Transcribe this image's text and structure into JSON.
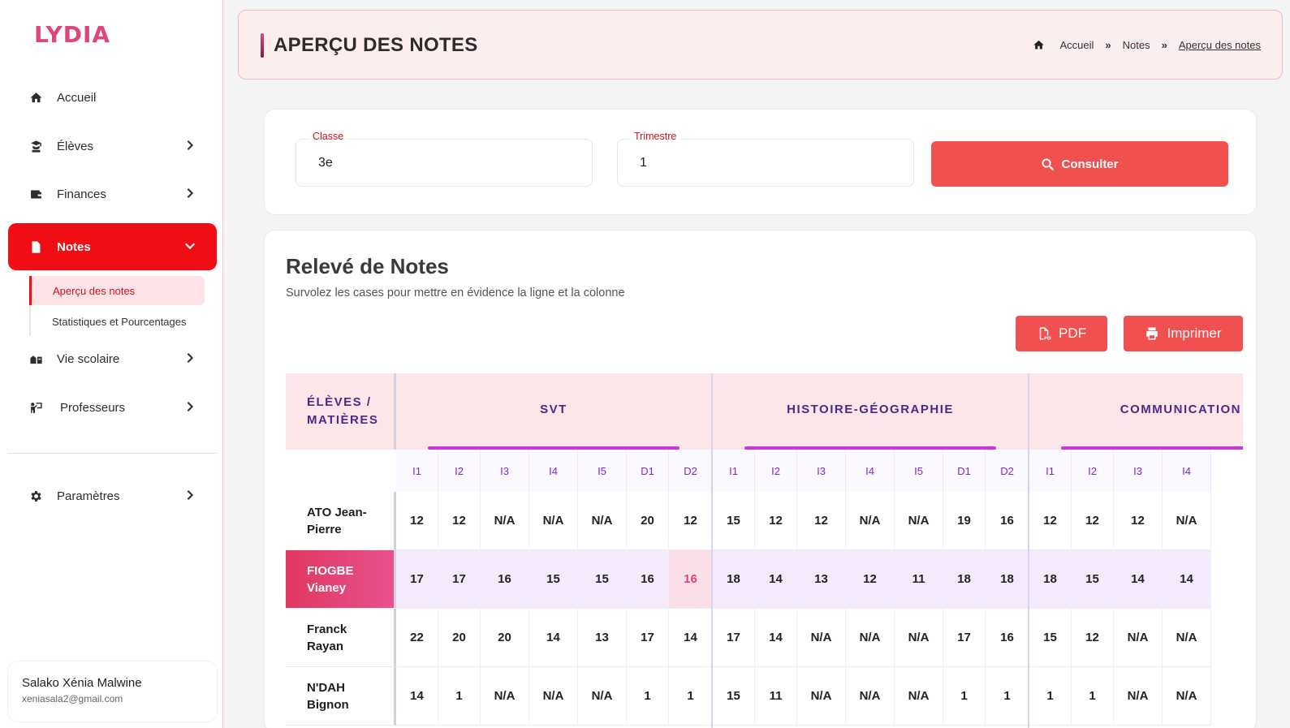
{
  "brand": "LYDIA",
  "sidebar": {
    "items": [
      {
        "label": "Accueil",
        "icon": "home-icon"
      },
      {
        "label": "Élèves",
        "icon": "student-icon"
      },
      {
        "label": "Finances",
        "icon": "wallet-icon"
      },
      {
        "label": "Notes",
        "icon": "document-icon"
      },
      {
        "label": "Vie scolaire",
        "icon": "school-life-icon"
      },
      {
        "label": "Professeurs",
        "icon": "teacher-icon"
      },
      {
        "label": "Paramètres",
        "icon": "gear-icon"
      }
    ],
    "sub_items": [
      "Aperçu des notes",
      "Statistiques et Pourcentages"
    ]
  },
  "user": {
    "name": "Salako Xénia Malwine",
    "email": "xeniasala2@gmail.com"
  },
  "header": {
    "title": "APERÇU DES NOTES",
    "breadcrumb": [
      "Accueil",
      "Notes",
      "Aperçu des notes"
    ]
  },
  "filters": {
    "classe_label": "Classe",
    "classe_value": "3e",
    "trimestre_label": "Trimestre",
    "trimestre_value": "1",
    "consult_label": "Consulter"
  },
  "grades": {
    "title": "Relevé de Notes",
    "hint": "Survolez les cases pour mettre en évidence la ligne et la colonne",
    "pdf_label": "PDF",
    "print_label": "Imprimer",
    "corner_label_1": "ÉLÈVES /",
    "corner_label_2": "MATIÈRES",
    "subjects": [
      "SVT",
      "HISTOIRE-GÉOGRAPHIE",
      "COMMUNICATION E"
    ],
    "evals": [
      "I1",
      "I2",
      "I3",
      "I4",
      "I5",
      "D1",
      "D2",
      "I1",
      "I2",
      "I3",
      "I4",
      "I5",
      "D1",
      "D2",
      "I1",
      "I2",
      "I3",
      "I4"
    ],
    "students": [
      {
        "line1": "ATO Jean-",
        "line2": "Pierre",
        "notes": [
          "12",
          "12",
          "N/A",
          "N/A",
          "N/A",
          "20",
          "12",
          "15",
          "12",
          "12",
          "N/A",
          "N/A",
          "19",
          "16",
          "12",
          "12",
          "12",
          "N/A"
        ]
      },
      {
        "line1": "FIOGBE",
        "line2": "Vianey",
        "notes": [
          "17",
          "17",
          "16",
          "15",
          "15",
          "16",
          "16",
          "18",
          "14",
          "13",
          "12",
          "11",
          "18",
          "18",
          "18",
          "15",
          "14",
          "14"
        ]
      },
      {
        "line1": "Franck",
        "line2": "Rayan",
        "notes": [
          "22",
          "20",
          "20",
          "14",
          "13",
          "17",
          "14",
          "17",
          "14",
          "N/A",
          "N/A",
          "N/A",
          "17",
          "16",
          "15",
          "12",
          "N/A",
          "N/A"
        ]
      },
      {
        "line1": "N'DAH",
        "line2": "Bignon",
        "notes": [
          "14",
          "1",
          "N/A",
          "N/A",
          "N/A",
          "1",
          "1",
          "15",
          "11",
          "N/A",
          "N/A",
          "N/A",
          "1",
          "1",
          "1",
          "1",
          "N/A",
          "N/A"
        ]
      }
    ]
  },
  "colors": {
    "accent": "#f00d14",
    "button": "#f05050",
    "header_bg": "#fdeeee",
    "subject_text": "#4a2a8a"
  }
}
